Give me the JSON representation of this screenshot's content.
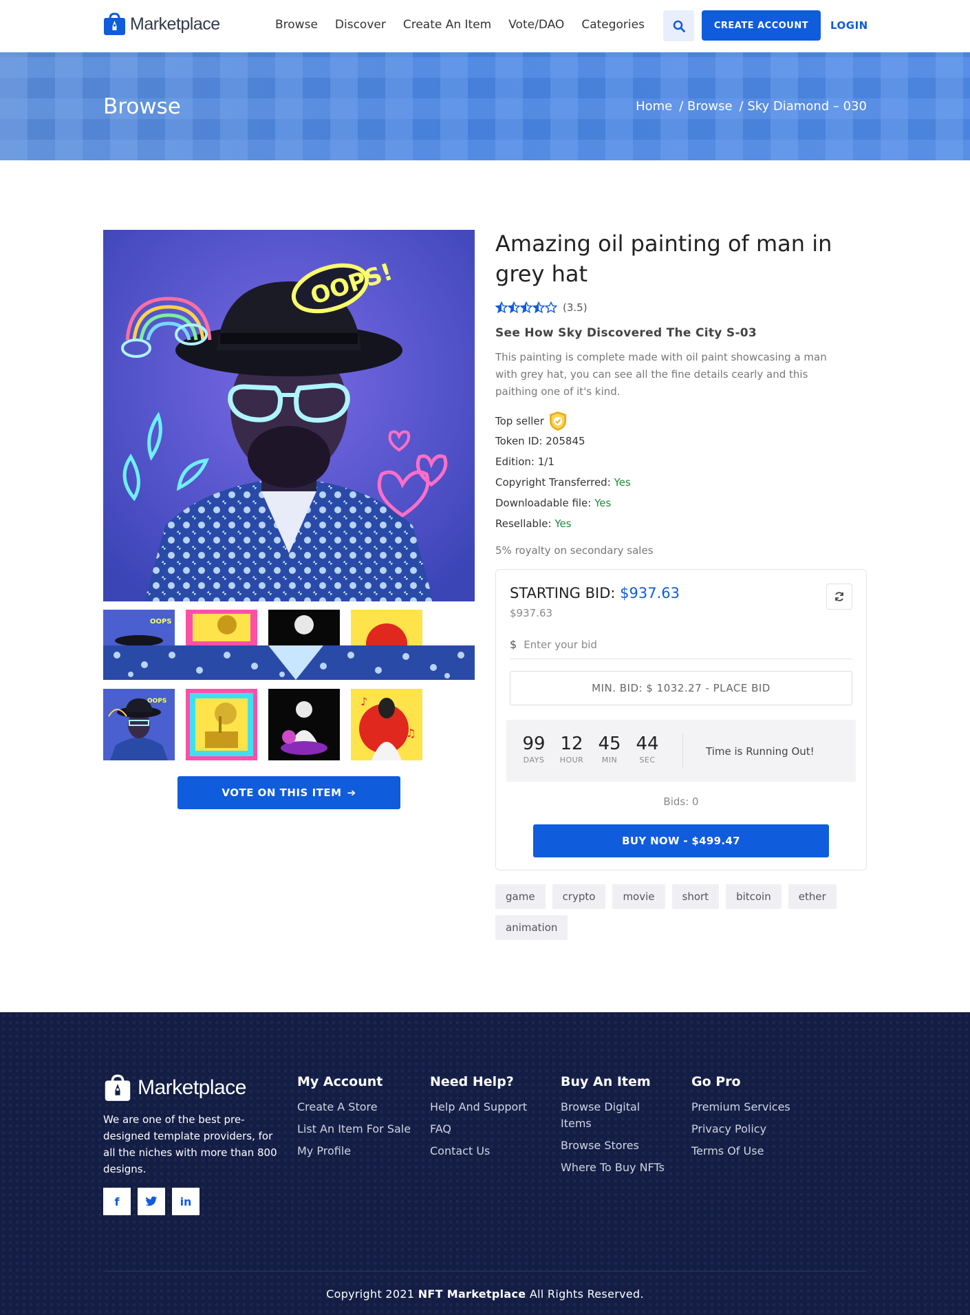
{
  "brand": {
    "name": "Marketplace"
  },
  "nav": {
    "links": [
      "Browse",
      "Discover",
      "Create An Item",
      "Vote/DAO",
      "Categories"
    ],
    "create_account": "CREATE ACCOUNT",
    "login": "LOGIN"
  },
  "banner": {
    "title": "Browse",
    "breadcrumbs": [
      "Home",
      "/ Browse",
      "/ Sky Diamond – 030"
    ]
  },
  "product": {
    "title": "Amazing oil painting of man in grey hat",
    "rating": "(3.5)",
    "rating_value": 3.5,
    "subtitle": "See How Sky Discovered The City S-03",
    "description": "This painting is complete made with oil paint showcasing a man with grey hat, you can see all the fine details cearly and this paithing one of it's kind.",
    "top_seller": "Top seller",
    "token_label": "Token ID:",
    "token_value": "205845",
    "edition_label": "Edition:",
    "edition_value": "1/1",
    "copyright_label": "Copyright Transferred:",
    "copyright_value": "Yes",
    "download_label": "Downloadable file:",
    "download_value": "Yes",
    "resell_label": "Resellable:",
    "resell_value": "Yes",
    "royalty": "5% royalty on secondary sales",
    "vote_button": "VOTE ON THIS ITEM"
  },
  "bid": {
    "heading": "STARTING BID:",
    "price": "$937.63",
    "sub_price": "$937.63",
    "currency_symbol": "$",
    "input_placeholder": "Enter your bid",
    "place_bid": "MIN. BID: $ 1032.27 - PLACE BID",
    "timer": [
      {
        "value": "99",
        "label": "DAYS"
      },
      {
        "value": "12",
        "label": "HOUR"
      },
      {
        "value": "45",
        "label": "MIN"
      },
      {
        "value": "44",
        "label": "SEC"
      }
    ],
    "timer_message": "Time is Running Out!",
    "bids_count": "Bids: 0",
    "buy_now": "BUY NOW - $499.47"
  },
  "tags": [
    "game",
    "crypto",
    "movie",
    "short",
    "bitcoin",
    "ether",
    "animation"
  ],
  "footer": {
    "about": "We are one of the best pre-designed template providers, for all the niches with more than 800 designs.",
    "socials": [
      "f",
      "t",
      "in"
    ],
    "columns": [
      {
        "title": "My Account",
        "items": [
          "Create A Store",
          "List An Item For Sale",
          "My Profile"
        ]
      },
      {
        "title": "Need Help?",
        "items": [
          "Help And Support",
          "FAQ",
          "Contact Us"
        ]
      },
      {
        "title": "Buy An Item",
        "items": [
          "Browse Digital Items",
          "Browse Stores",
          "Where To Buy NFTs"
        ]
      },
      {
        "title": "Go Pro",
        "items": [
          "Premium Services",
          "Privacy Policy",
          "Terms Of Use"
        ]
      }
    ],
    "copyright_prefix": "Copyright 2021",
    "copyright_brand": "NFT Marketplace",
    "copyright_suffix": "All Rights Reserved."
  },
  "colors": {
    "accent": "#0f5cdd",
    "footer_bg": "#141e44",
    "banner": "#4a86e4",
    "green": "#1f8a3a"
  }
}
